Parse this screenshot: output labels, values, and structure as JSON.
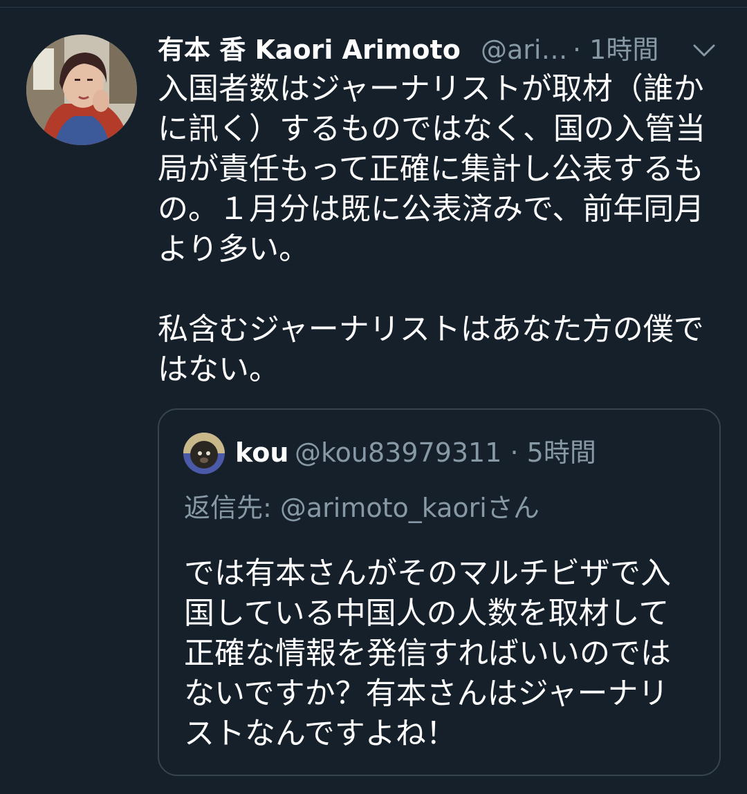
{
  "theme": {
    "background": "#15202b",
    "text_primary": "#ffffff",
    "text_secondary": "#8899a6",
    "border": "#38444d"
  },
  "tweet": {
    "display_name": "有本 香  Kaori Arimoto",
    "handle": "@ari…",
    "separator_time": "· 1時間",
    "menu_icon": "chevron-down-icon",
    "body_lines_1": "入国者数はジャーナリストが取材（誰かに訊く）するものではなく、国の入管当局が責任もって正確に集計し公表するもの。１月分は既に公表済みで、前年同月より多い。",
    "body_lines_2": "私含むジャーナリストはあなた方の僕ではない。"
  },
  "quote": {
    "display_name": "kou",
    "handle_time": "@kou83979311 · 5時間",
    "reply_to": "返信先: @arimoto_kaoriさん",
    "body": "では有本さんがそのマルチビザで入国している中国人の人数を取材して正確な情報を発信すればいいのではないですか？有本さんはジャーナリストなんですよね！"
  }
}
